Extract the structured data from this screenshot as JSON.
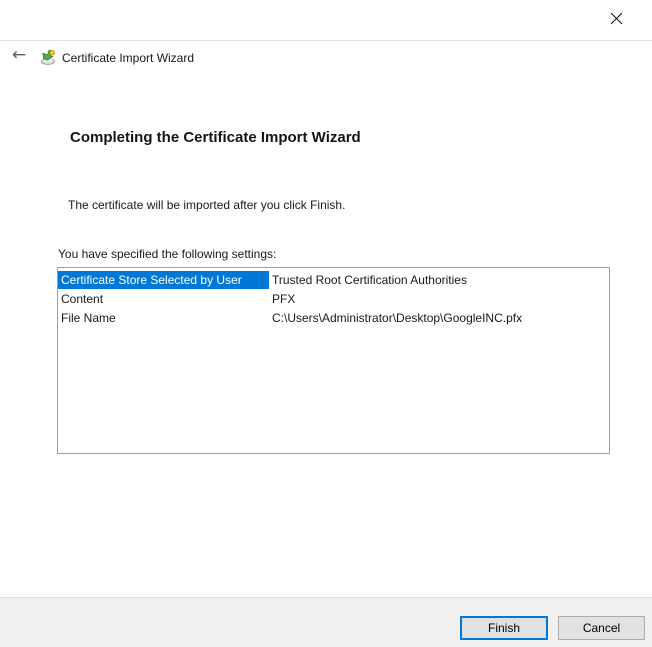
{
  "window": {
    "close_icon": "close-x"
  },
  "header": {
    "back_arrow": "←",
    "icon": "certificate-import-wizard-icon",
    "title": "Certificate Import Wizard"
  },
  "content": {
    "heading": "Completing the Certificate Import Wizard",
    "description": "The certificate will be imported after you click Finish.",
    "settings_label": "You have specified the following settings:",
    "settings": [
      {
        "name": "Certificate Store Selected by User",
        "value": "Trusted Root Certification Authorities",
        "selected": true
      },
      {
        "name": "Content",
        "value": "PFX",
        "selected": false
      },
      {
        "name": "File Name",
        "value": "C:\\Users\\Administrator\\Desktop\\GoogleINC.pfx",
        "selected": false
      }
    ]
  },
  "footer": {
    "finish_label": "Finish",
    "cancel_label": "Cancel"
  },
  "colors": {
    "selection_blue": "#0078d7",
    "button_face": "#e1e1e1",
    "button_border": "#adadad",
    "default_button_border": "#0078d7",
    "footer_background": "#f0f0f0",
    "separator": "#e0e0e0",
    "listbox_border": "#a0a0a0"
  }
}
